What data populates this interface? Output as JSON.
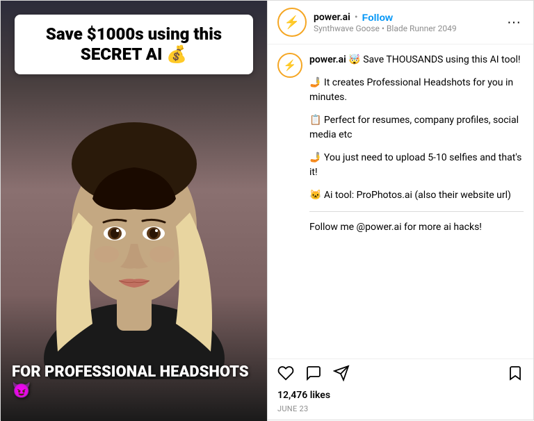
{
  "media": {
    "top_text": "Save $1000s using this SECRET AI 💰",
    "bottom_text": "FOR PROFESSIONAL HEADSHOTS 😈"
  },
  "header": {
    "username": "power.ai",
    "dot": "•",
    "follow_label": "Follow",
    "subtitle": "Synthwave Goose • Blade Runner 2049",
    "more_label": "···"
  },
  "caption": {
    "username": "power.ai",
    "lines": [
      "🤯 Save THOUSANDS using this AI tool!",
      "🤳 It creates Professional Headshots for you in minutes.",
      "📋 Perfect for resumes, company profiles, social media etc",
      "🤳 You just need to upload 5-10 selfies and that's it!",
      "🐱 Ai tool: ProPhotos.ai (also their website url)",
      "Follow me @power.ai for more ai hacks!"
    ]
  },
  "meta": {
    "likes": "12,476 likes",
    "date": "JUNE 23"
  },
  "actions": {
    "like_label": "like",
    "comment_label": "comment",
    "share_label": "share",
    "bookmark_label": "bookmark"
  }
}
